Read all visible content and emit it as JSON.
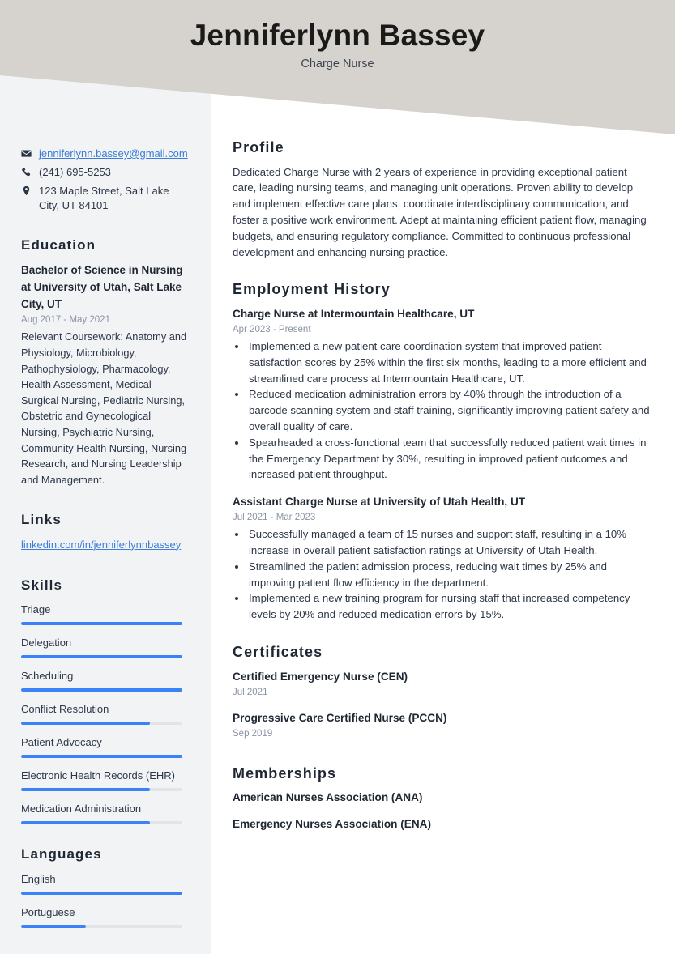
{
  "colors": {
    "accent": "#3b82f6",
    "banner": "#d6d2cd",
    "sidebar": "#f1f3f5",
    "text": "#2d3748",
    "muted": "#8b94a3",
    "link": "#3b7dd8"
  },
  "header": {
    "name": "Jenniferlynn Bassey",
    "title": "Charge Nurse"
  },
  "contact": {
    "email": "jenniferlynn.bassey@gmail.com",
    "phone": "(241) 695-5253",
    "address": "123 Maple Street, Salt Lake City, UT 84101",
    "icons": {
      "email": "envelope-icon",
      "phone": "phone-icon",
      "address": "map-pin-icon"
    }
  },
  "education": {
    "heading": "Education",
    "entries": [
      {
        "title": "Bachelor of Science in Nursing at University of Utah, Salt Lake City, UT",
        "date": "Aug 2017 - May 2021",
        "body": "Relevant Coursework: Anatomy and Physiology, Microbiology, Pathophysiology, Pharmacology, Health Assessment, Medical-Surgical Nursing, Pediatric Nursing, Obstetric and Gynecological Nursing, Psychiatric Nursing, Community Health Nursing, Nursing Research, and Nursing Leadership and Management."
      }
    ]
  },
  "links": {
    "heading": "Links",
    "items": [
      {
        "label": "linkedin.com/in/jenniferlynnbassey"
      }
    ]
  },
  "skills": {
    "heading": "Skills",
    "items": [
      {
        "label": "Triage",
        "level": 100
      },
      {
        "label": "Delegation",
        "level": 100
      },
      {
        "label": "Scheduling",
        "level": 100
      },
      {
        "label": "Conflict Resolution",
        "level": 80
      },
      {
        "label": "Patient Advocacy",
        "level": 100
      },
      {
        "label": "Electronic Health Records (EHR)",
        "level": 80
      },
      {
        "label": "Medication Administration",
        "level": 80
      }
    ]
  },
  "languages": {
    "heading": "Languages",
    "items": [
      {
        "label": "English",
        "level": 100
      },
      {
        "label": "Portuguese",
        "level": 40
      }
    ]
  },
  "profile": {
    "heading": "Profile",
    "text": "Dedicated Charge Nurse with 2 years of experience in providing exceptional patient care, leading nursing teams, and managing unit operations. Proven ability to develop and implement effective care plans, coordinate interdisciplinary communication, and foster a positive work environment. Adept at maintaining efficient patient flow, managing budgets, and ensuring regulatory compliance. Committed to continuous professional development and enhancing nursing practice."
  },
  "employment": {
    "heading": "Employment History",
    "jobs": [
      {
        "title": "Charge Nurse at Intermountain Healthcare, UT",
        "date": "Apr 2023 - Present",
        "bullets": [
          "Implemented a new patient care coordination system that improved patient satisfaction scores by 25% within the first six months, leading to a more efficient and streamlined care process at Intermountain Healthcare, UT.",
          "Reduced medication administration errors by 40% through the introduction of a barcode scanning system and staff training, significantly improving patient safety and overall quality of care.",
          "Spearheaded a cross-functional team that successfully reduced patient wait times in the Emergency Department by 30%, resulting in improved patient outcomes and increased patient throughput."
        ]
      },
      {
        "title": "Assistant Charge Nurse at University of Utah Health, UT",
        "date": "Jul 2021 - Mar 2023",
        "bullets": [
          "Successfully managed a team of 15 nurses and support staff, resulting in a 10% increase in overall patient satisfaction ratings at University of Utah Health.",
          "Streamlined the patient admission process, reducing wait times by 25% and improving patient flow efficiency in the department.",
          "Implemented a new training program for nursing staff that increased competency levels by 20% and reduced medication errors by 15%."
        ]
      }
    ]
  },
  "certificates": {
    "heading": "Certificates",
    "items": [
      {
        "title": "Certified Emergency Nurse (CEN)",
        "date": "Jul 2021"
      },
      {
        "title": "Progressive Care Certified Nurse (PCCN)",
        "date": "Sep 2019"
      }
    ]
  },
  "memberships": {
    "heading": "Memberships",
    "items": [
      {
        "title": "American Nurses Association (ANA)"
      },
      {
        "title": "Emergency Nurses Association (ENA)"
      }
    ]
  }
}
